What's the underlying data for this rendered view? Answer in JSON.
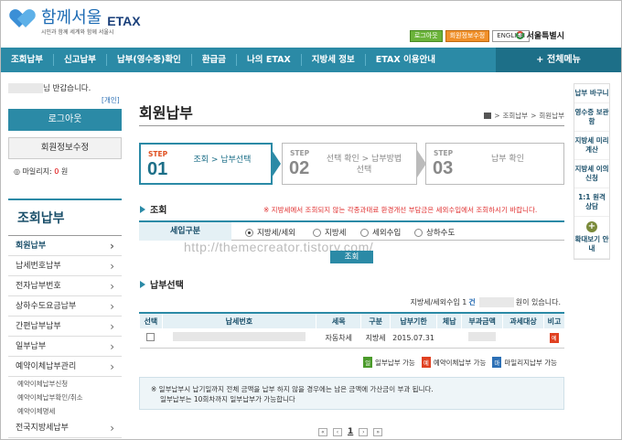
{
  "header": {
    "logo_name": "함께서울",
    "logo_sub": "시민과 함께 세계와 함께 서울시",
    "logo_etax": "ETAX",
    "btn_login": "로그아웃",
    "btn_member": "회원정보수정",
    "btn_english": "ENGLISH",
    "seoul": "서울특별시"
  },
  "nav": {
    "items": [
      "조회납부",
      "신고납부",
      "납부(영수증)확인",
      "환급금",
      "나의 ETAX",
      "지방세 정보",
      "ETAX 이용안내"
    ],
    "all_menu": "+ 전체메뉴"
  },
  "left": {
    "greet": "님 반갑습니다.",
    "personal": "[개인]",
    "logout": "로그아웃",
    "member_edit": "회원정보수정",
    "mileage_label": "마일리지:",
    "mileage_value": "0",
    "mileage_unit": "원",
    "menu_title": "조회납부",
    "menu": [
      {
        "label": "회원납부",
        "type": "main",
        "active": true
      },
      {
        "label": "납세번호납부",
        "type": "main"
      },
      {
        "label": "전자납부번호",
        "type": "main"
      },
      {
        "label": "상하수도요금납부",
        "type": "main"
      },
      {
        "label": "간편납부납부",
        "type": "main"
      },
      {
        "label": "일부납부",
        "type": "main"
      },
      {
        "label": "예약이체납부관리",
        "type": "main"
      },
      {
        "label": "예약이체납부신청",
        "type": "sub"
      },
      {
        "label": "예약이체납부확인/취소",
        "type": "sub"
      },
      {
        "label": "예약이체명세",
        "type": "sub"
      },
      {
        "label": "전국지방세납부",
        "type": "main"
      }
    ]
  },
  "main": {
    "title": "회원납부",
    "breadcrumb": [
      "조회납부",
      "회원납부"
    ],
    "steps": [
      {
        "label": "STEP",
        "num": "01",
        "text": "조회 > 납부선택"
      },
      {
        "label": "STEP",
        "num": "02",
        "text": "선택 확인 > 납부방법 선택"
      },
      {
        "label": "STEP",
        "num": "03",
        "text": "납부 확인"
      }
    ],
    "query_title": "조회",
    "query_note": "※ 지방세에서 조회되지 않는 각종과태료 환경개선 부담금은 세외수입에서 조회하시기 바랍니다.",
    "query_label": "세입구분",
    "radios": [
      "지방세/세외",
      "지방세",
      "세외수입",
      "상하수도"
    ],
    "query_btn": "조회",
    "watermark": "http://themecreator.tistory.com/",
    "select_title": "납부선택",
    "count_pre": "지방세/세외수입 1",
    "count_unit": "건",
    "count_post": "원이 있습니다.",
    "columns": [
      "선택",
      "납세번호",
      "세목",
      "구분",
      "납부기한",
      "체납",
      "부과금액",
      "과세대상",
      "비고"
    ],
    "rows": [
      {
        "tax": "자동차세",
        "kind": "지방세",
        "due": "2015.07.31",
        "note": "예"
      }
    ],
    "legend": [
      {
        "badge": "일",
        "text": "일부납부 가능",
        "color": "#4a9a2a"
      },
      {
        "badge": "예",
        "text": "예약이체납부 가능",
        "color": "#e04020"
      },
      {
        "badge": "마",
        "text": "마일리지납부 가능",
        "color": "#2b6fb5"
      }
    ],
    "info": [
      "※ 일부납부시 납기일까지 전체 금액을 납부 하지 않을 경우에는 남은 금액에 가산금이 부과 됩니다.",
      "일부납부는 10회차까지 일부납부가 가능합니다"
    ],
    "page": "1"
  },
  "quick": [
    "납부 바구니",
    "영수증 보관함",
    "지방세 미리계산",
    "지방세 이의신청",
    "1:1 원격 상담",
    "확대보기 안내"
  ]
}
